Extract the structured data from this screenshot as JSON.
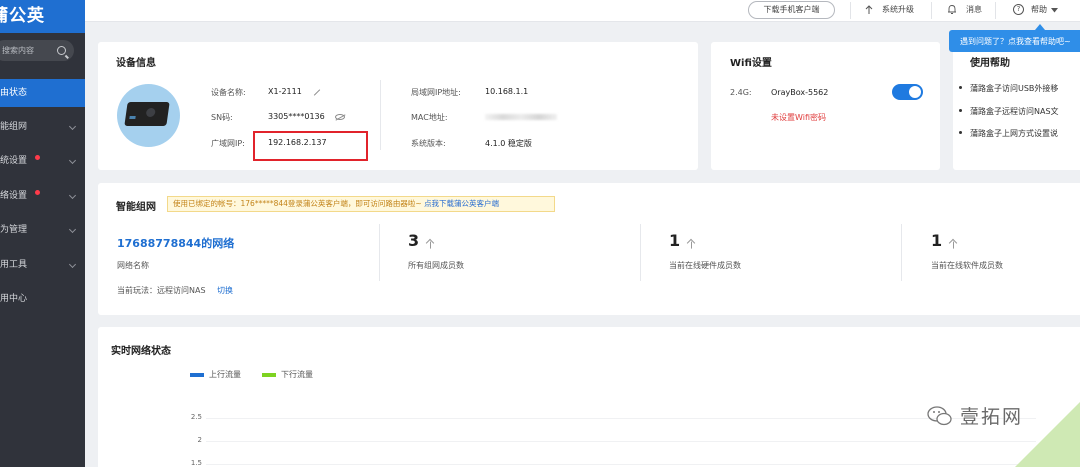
{
  "sidebar": {
    "logo": "蒲公英",
    "search_placeholder": "搜索内容",
    "items": [
      {
        "label": "路由状态"
      },
      {
        "label": "智能组网"
      },
      {
        "label": "系统设置"
      },
      {
        "label": "网络设置"
      },
      {
        "label": "行为管理"
      },
      {
        "label": "实用工具"
      },
      {
        "label": "应用中心"
      }
    ]
  },
  "topbar": {
    "download_label": "下载手机客户端",
    "upgrade_label": "系统升级",
    "messages_label": "消息",
    "help_label": "帮助"
  },
  "tooltip": {
    "text": "遇到问题了？点我查看帮助吧~"
  },
  "device": {
    "title": "设备信息",
    "name_label": "设备名称:",
    "name_value": "X1-2111",
    "sn_label": "SN码:",
    "sn_value": "3305****0136",
    "wan_ip_label": "广域网IP:",
    "wan_ip_value": "192.168.2.137",
    "lan_ip_label": "局域网IP地址:",
    "lan_ip_value": "10.168.1.1",
    "mac_label": "MAC地址:",
    "version_label": "系统版本:",
    "version_value": "4.1.0 稳定版"
  },
  "wifi": {
    "title": "Wifi设置",
    "band": "2.4G:",
    "ssid": "OrayBox-5562",
    "enabled": true,
    "warning": "未设置Wifi密码"
  },
  "help": {
    "title": "使用帮助",
    "items": [
      "蒲路盒子访问USB外接移",
      "蒲路盒子远程访问NAS文",
      "蒲路盒子上网方式设置说"
    ]
  },
  "smart_network": {
    "title": "智能组网",
    "notice_text": "使用已绑定的帐号：176*****844登录蒲公英客户端，即可访问路由器啦~",
    "notice_link": "点我下载蒲公英客户端",
    "network_name": "17688778844的网络",
    "network_name_label": "网络名称",
    "members": "3",
    "members_label": "所有组网成员数",
    "hw_online": "1",
    "hw_online_label": "当前在线硬件成员数",
    "sw_online": "1",
    "sw_online_label": "当前在线软件成员数",
    "mode_label": "当前玩法：远程访问NAS",
    "switch_label": "切换"
  },
  "realtime": {
    "title": "实时网络状态",
    "upload_legend": "上行流量",
    "download_legend": "下行流量",
    "upload_color": "#1f6fd1",
    "download_color": "#7ed321",
    "y_ticks": [
      "2.5",
      "2",
      "1.5"
    ]
  },
  "watermark": {
    "text": "壹拓网"
  }
}
